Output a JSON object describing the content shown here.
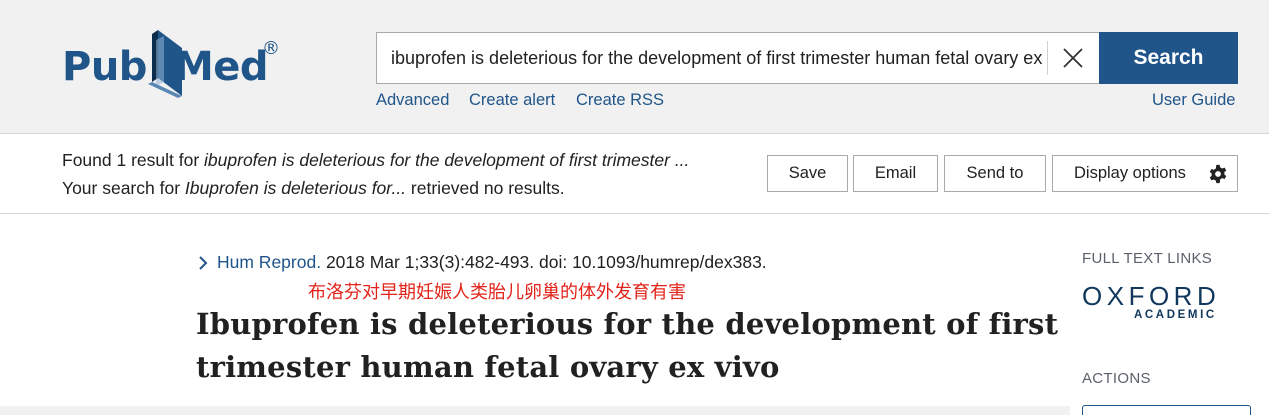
{
  "header": {
    "logo": {
      "pub": "Pub",
      "med": "Med",
      "reg": "®"
    },
    "search": {
      "value": "ibuprofen is deleterious for the development of first trimester human fetal ovary ex vivo",
      "button": "Search"
    },
    "links": {
      "advanced": "Advanced",
      "create_alert": "Create alert",
      "create_rss": "Create RSS",
      "user_guide": "User Guide"
    }
  },
  "results": {
    "found_prefix": "Found 1 result for ",
    "found_query": "ibuprofen is deleterious for the development of first trimester ...",
    "search_prefix": "Your search for ",
    "search_query": "Ibuprofen is deleterious for...",
    "search_suffix": "  retrieved no results.",
    "buttons": {
      "save": "Save",
      "email": "Email",
      "send_to": "Send to",
      "display_options": "Display options"
    }
  },
  "article": {
    "journal": "Hum Reprod.",
    "citation": " 2018 Mar 1;33(3):482-493. doi: 10.1093/humrep/dex383.",
    "translation": "布洛芬对早期妊娠人类胎儿卵巢的体外发育有害",
    "title": "Ibuprofen is deleterious for the development of first trimester human fetal ovary ex vivo"
  },
  "sidebar": {
    "full_text_links": "FULL TEXT LINKS",
    "oxford": "OXFORD",
    "academic": "ACADEMIC",
    "actions": "ACTIONS"
  },
  "colors": {
    "brand_blue": "#20558a",
    "annotation_red": "#e2231a",
    "header_bg": "#f1f1f1"
  }
}
